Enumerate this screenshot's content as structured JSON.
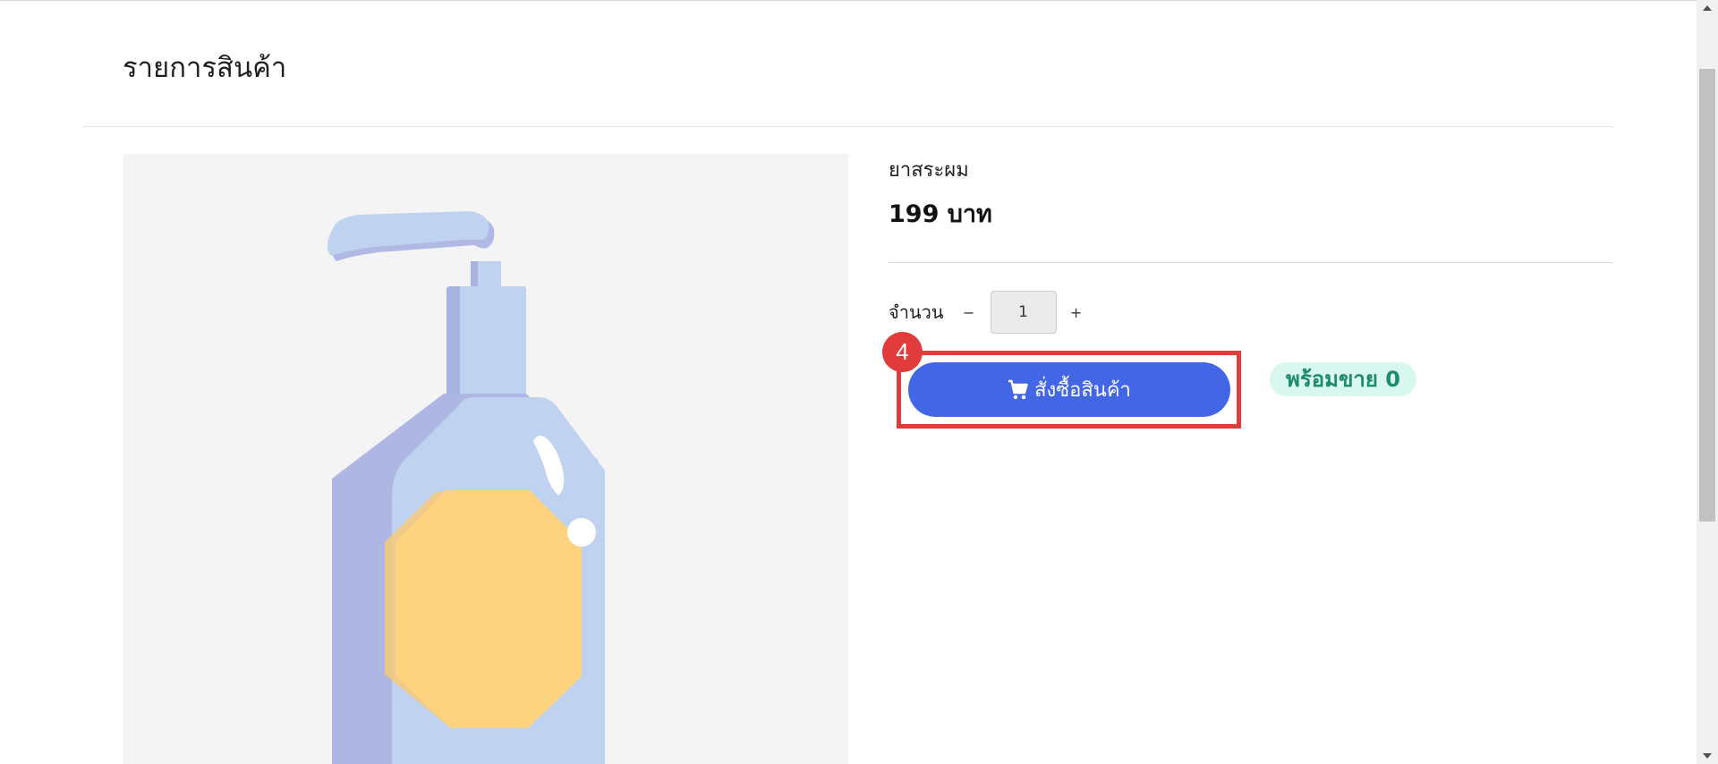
{
  "page": {
    "title": "รายการสินค้า"
  },
  "product": {
    "name": "ยาสระผม",
    "price": "199 บาท",
    "image_icon": "shampoo-bottle-illustration"
  },
  "quantity": {
    "label": "จำนวน",
    "minus": "−",
    "plus": "+",
    "value": "1"
  },
  "order": {
    "button_label": "สั่งซื้อสินค้า",
    "icon": "cart-icon",
    "step_number": "4"
  },
  "stock": {
    "label": "พร้อมขาย 0"
  },
  "colors": {
    "button": "#4266e6",
    "highlight": "#e23b3b",
    "stock_bg": "#d8f7ee",
    "stock_text": "#1f8a6e"
  }
}
